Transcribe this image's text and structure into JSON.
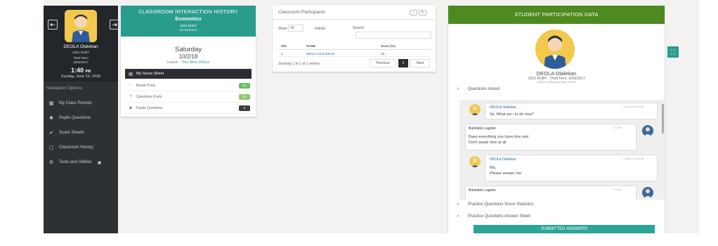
{
  "sidebar": {
    "left_button_icon": "exit-icon",
    "right_button_icon": "enter-icon",
    "user_name": "DEOLA Olalekan",
    "class_name": "JSS1 RUBY",
    "term": "Third Term",
    "session": "2016/2017",
    "time": "1:40",
    "time_suffix": "PM",
    "date": "Sunday, June 10, 2018",
    "nav_title": "Navigation Options",
    "items": [
      {
        "label": "My Class Periods",
        "icon": "calendar-icon"
      },
      {
        "label": "Pupils Questions",
        "icon": "star-icon"
      },
      {
        "label": "Score Sheets",
        "icon": "check-icon"
      },
      {
        "label": "Classroom History",
        "icon": "window-icon"
      },
      {
        "label": "Tools and Utilities",
        "icon": "gears-icon"
      }
    ]
  },
  "history": {
    "title": "CLASSROOM INTERACTION HISTORY",
    "subject": "Economics",
    "class_name": "JSS1 RUBY",
    "code": "ECONOMICS",
    "day": "Saturday",
    "date": "10/2/18",
    "lesson_prefix": "Lesson : ",
    "lesson_link": "Thru Wins 10Secs",
    "score_sheet_label": "My Score Sheet",
    "rows": [
      {
        "label": "Board Posts",
        "count": "12",
        "badge": "green"
      },
      {
        "label": "Questions Posts",
        "count": "19",
        "badge": "olive"
      },
      {
        "label": "Pupils Questions",
        "count": "6",
        "badge": "dark"
      }
    ]
  },
  "participants": {
    "title": "Classroom Participants",
    "show_label": "Show",
    "entries_value": "10",
    "entries_label": "entries",
    "search_label": "Search:",
    "columns": [
      "S/N",
      "NAME",
      "Score (%)"
    ],
    "rows": [
      {
        "sn": "1",
        "name": "DEOLA OLALEKAN",
        "score": "33"
      }
    ],
    "info": "Showing 1 to 1 of 1 entries",
    "pager": {
      "previous": "Previous",
      "page": "1",
      "next": "Next"
    }
  },
  "student": {
    "title": "STUDENT PARTICIPATION DATA",
    "name": "DEOLA Olalekan",
    "class_info": "JSS1 RUBY , Third Term, 2016/2017",
    "last_seen": "Joined on Saturday 9:05am 10/2/18",
    "sections": {
      "questions_asked": "Questions Asked",
      "practice_stats": "Practice Questions Score Statistics",
      "practice_answers": "Practice Questions Answer Sheet"
    },
    "messages": [
      {
        "name": "DEOLA Olalekan",
        "time": "1:17pm on 10/2/18",
        "lines": [
          "Sir, What am i to do now?"
        ]
      },
      {
        "name": "Bamidele Lagoke",
        "time": "1:17pm",
        "lines": [
          "Base everything you have fore real",
          "Don't waste time at all"
        ]
      },
      {
        "name": "DEOLA Olalekan",
        "time": "1:18pm on 10/2/18",
        "lines": [
          "Ma,",
          "Please answer me"
        ]
      },
      {
        "name": "Bamidele Lagoke",
        "time": "1:18pm",
        "lines": [
          ""
        ]
      }
    ],
    "submitted_label": "SUBMITTED ANSWERS"
  },
  "colors": {
    "sidebar": "#2e3134",
    "teal": "#2a9c8d",
    "green_header": "#4d8a1f",
    "avatar_yellow": "#f2c94c"
  }
}
